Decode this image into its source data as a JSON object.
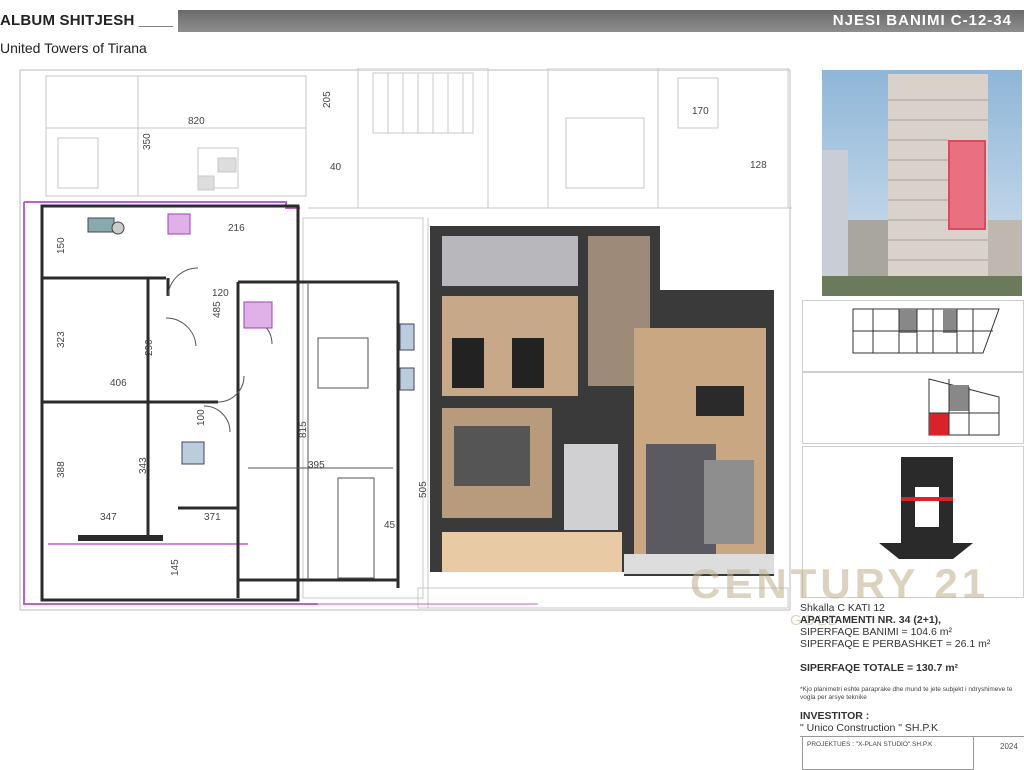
{
  "header": {
    "album": "ALBUM SHITJESH ____",
    "project": "United  Towers of Tirana",
    "unit_title": "NJESI BANIMI C-12-34"
  },
  "drawing": {
    "dimensions": [
      "820",
      "350",
      "205",
      "216",
      "150",
      "120",
      "485",
      "323",
      "290",
      "406",
      "100",
      "815",
      "395",
      "388",
      "343",
      "347",
      "371",
      "145",
      "45",
      "128",
      "170",
      "40",
      "505"
    ]
  },
  "watermark": {
    "brand": "CENTURY 21",
    "sub": "GOLD"
  },
  "info": {
    "floor": "Shkalla C KATI 12",
    "apartment": "APARTAMENTI NR. 34 (2+1),",
    "living_area": "SIPERFAQE BANIMI = 104.6 m²",
    "common_area": "SIPERFAQE E PERBASHKET = 26.1 m²",
    "total_area": "SIPERFAQE TOTALE = 130.7 m²",
    "note": "*Kjo planimetri eshte paraprake dhe mund te jete subjekt i ndryshimeve te vogla per arsye teknike",
    "investor_label": "INVESTITOR :",
    "investor": "\" Unico Construction \" SH.P.K",
    "projektues": "PROJEKTUES : \"X-PLAN STUDIO\" SH.P.K",
    "page": "2024"
  },
  "colors": {
    "wall": "#2b2b2b",
    "magenta": "#c05fd0",
    "accent_red": "#d8232a",
    "title_bar": "#7b7b7b",
    "watermark": "#bfae8a"
  }
}
